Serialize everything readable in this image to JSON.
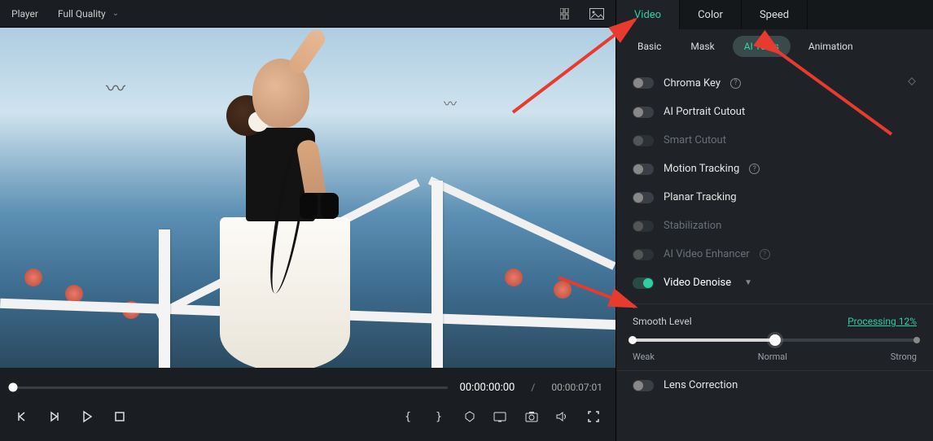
{
  "player": {
    "label": "Player",
    "quality": "Full Quality"
  },
  "time": {
    "current": "00:00:00:00",
    "total": "00:00:07:01",
    "separator": "/"
  },
  "top_tabs": {
    "video": "Video",
    "color": "Color",
    "speed": "Speed"
  },
  "sub_tabs": {
    "basic": "Basic",
    "mask": "Mask",
    "ai_tools": "AI Tools",
    "animation": "Animation"
  },
  "tools": {
    "chroma_key": "Chroma Key",
    "ai_portrait_cutout": "AI Portrait Cutout",
    "smart_cutout": "Smart Cutout",
    "motion_tracking": "Motion Tracking",
    "planar_tracking": "Planar Tracking",
    "stabilization": "Stabilization",
    "ai_video_enhancer": "AI Video Enhancer",
    "video_denoise": "Video Denoise",
    "lens_correction": "Lens Correction"
  },
  "denoise": {
    "smooth_level": "Smooth Level",
    "processing": "Processing 12%",
    "weak": "Weak",
    "normal": "Normal",
    "strong": "Strong"
  }
}
